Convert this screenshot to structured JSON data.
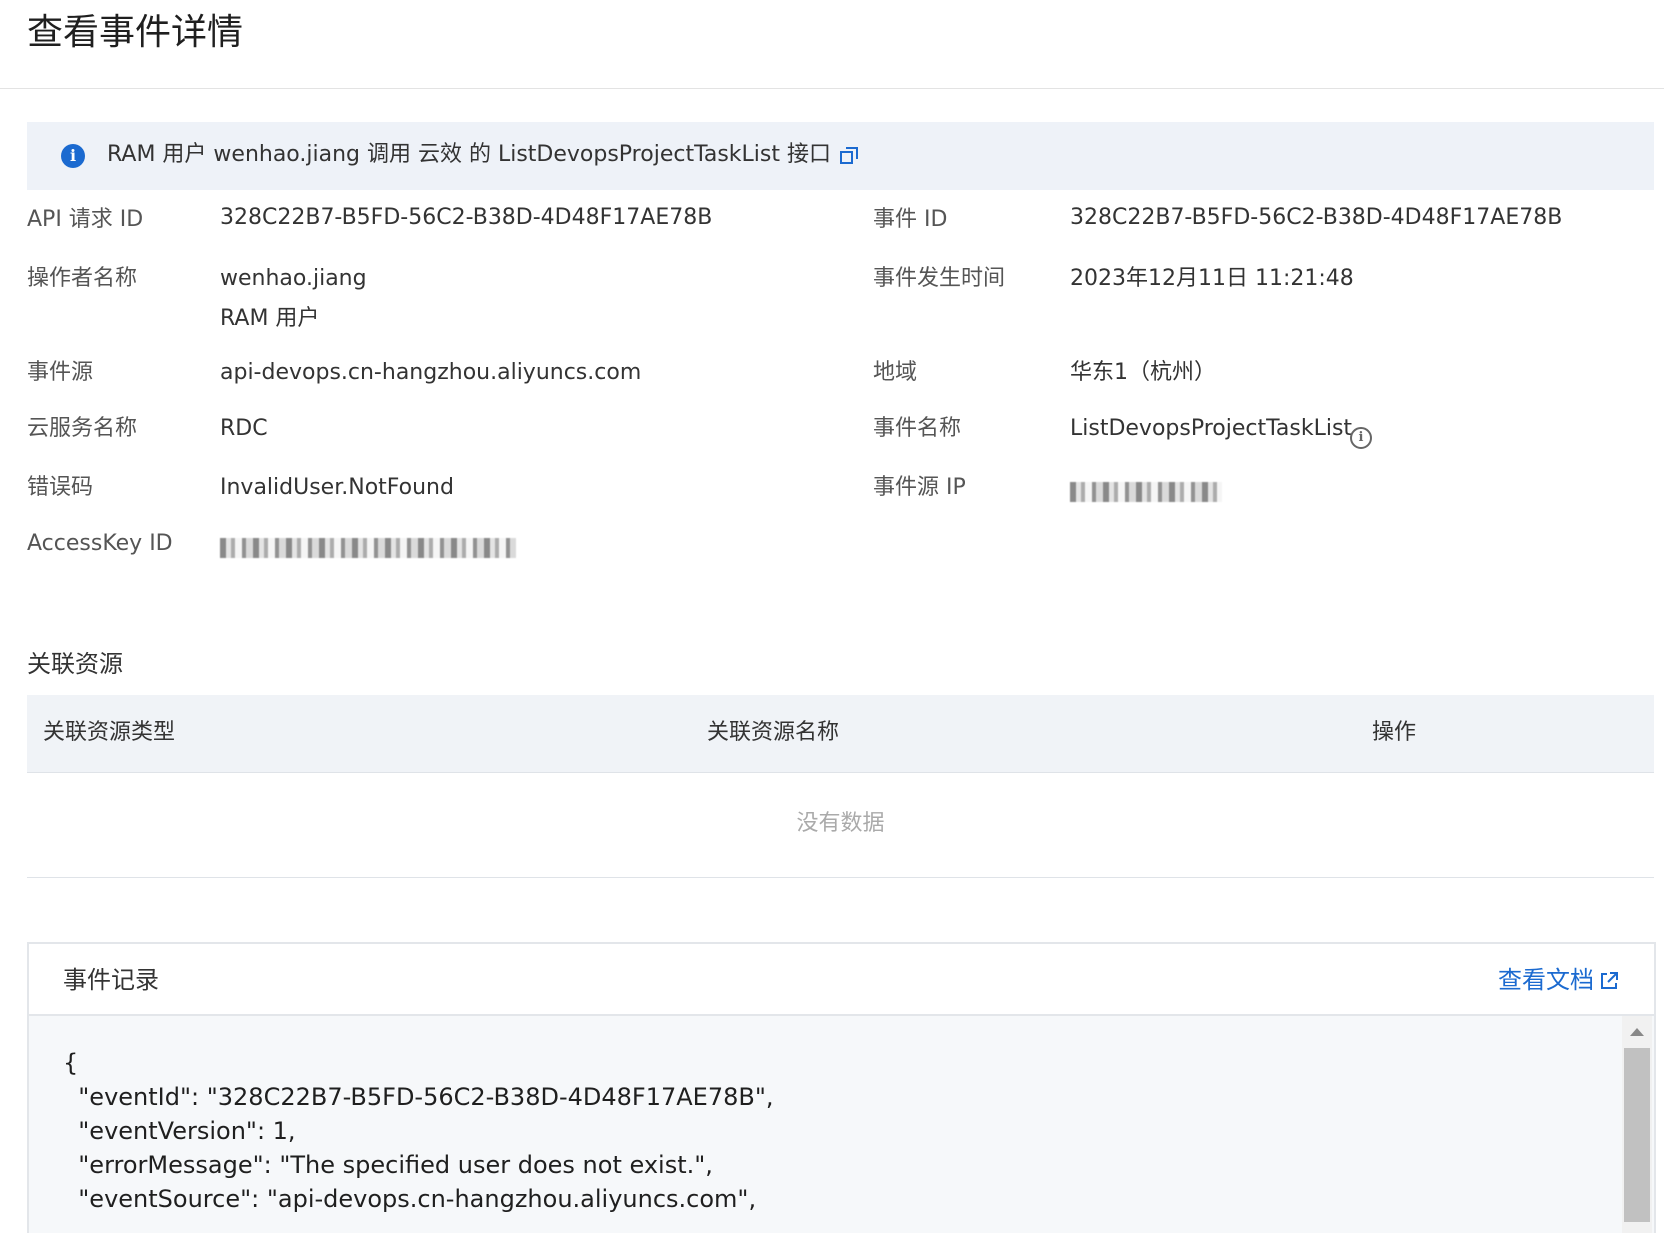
{
  "page": {
    "title": "查看事件详情"
  },
  "banner": {
    "text": "RAM 用户 wenhao.jiang 调用 云效 的 ListDevopsProjectTaskList 接口"
  },
  "fields": {
    "api_request_id": {
      "label": "API 请求 ID",
      "value": "328C22B7-B5FD-56C2-B38D-4D48F17AE78B"
    },
    "event_id": {
      "label": "事件 ID",
      "value": "328C22B7-B5FD-56C2-B38D-4D48F17AE78B"
    },
    "operator_name": {
      "label": "操作者名称",
      "value": "wenhao.jiang",
      "value2": "RAM 用户"
    },
    "event_time": {
      "label": "事件发生时间",
      "value": "2023年12月11日 11:21:48"
    },
    "event_source": {
      "label": "事件源",
      "value": "api-devops.cn-hangzhou.aliyuncs.com"
    },
    "region": {
      "label": "地域",
      "value": "华东1（杭州）"
    },
    "service_name": {
      "label": "云服务名称",
      "value": "RDC"
    },
    "event_name": {
      "label": "事件名称",
      "value": "ListDevopsProjectTaskList"
    },
    "error_code": {
      "label": "错误码",
      "value": "InvalidUser.NotFound"
    },
    "event_source_ip": {
      "label": "事件源 IP"
    },
    "access_key_id": {
      "label": "AccessKey ID"
    }
  },
  "related": {
    "title": "关联资源",
    "columns": [
      "关联资源类型",
      "关联资源名称",
      "操作"
    ],
    "empty_text": "没有数据"
  },
  "record": {
    "title": "事件记录",
    "doc_link": "查看文档",
    "lines": [
      "{",
      "  \"eventId\": \"328C22B7-B5FD-56C2-B38D-4D48F17AE78B\",",
      "  \"eventVersion\": 1,",
      "  \"errorMessage\": \"The specified user does not exist.\",",
      "  \"eventSource\": \"api-devops.cn-hangzhou.aliyuncs.com\","
    ]
  }
}
